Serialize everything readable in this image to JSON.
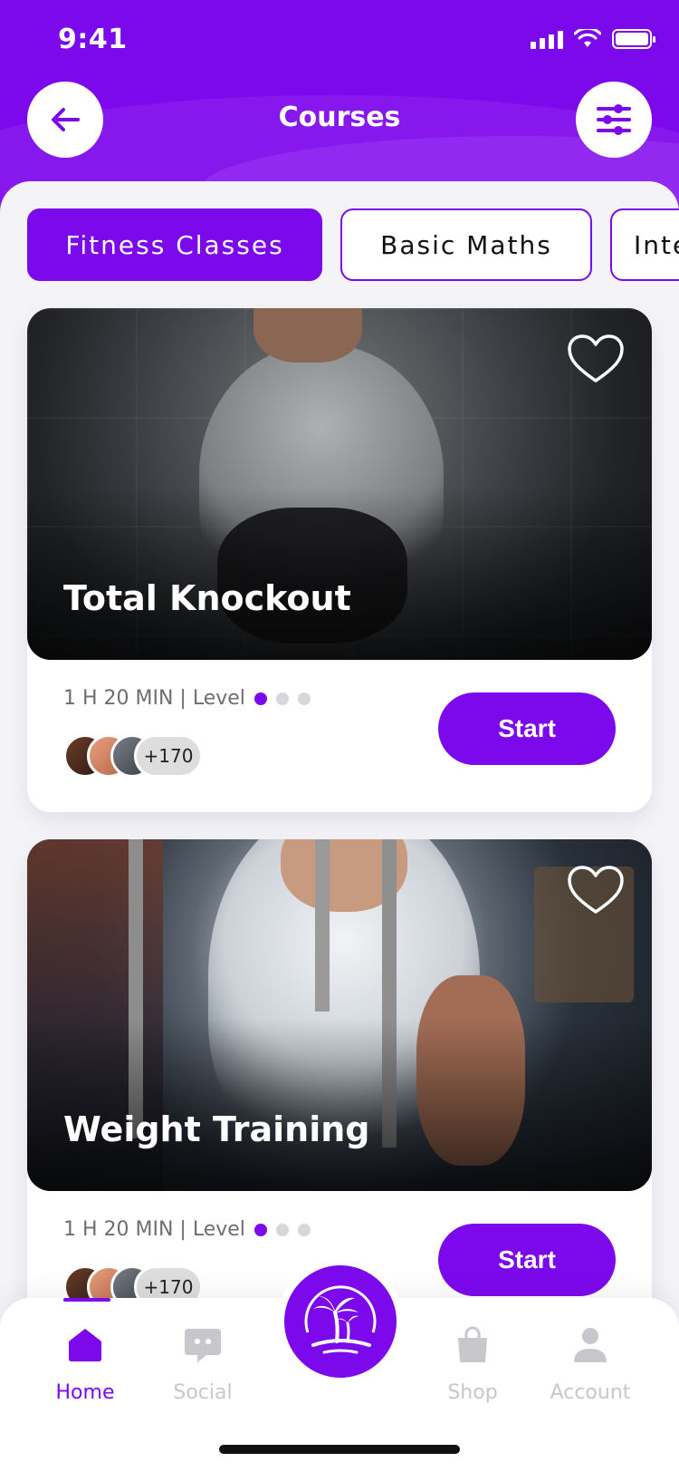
{
  "status_bar": {
    "time": "9:41"
  },
  "header": {
    "title": "Courses"
  },
  "tabs": [
    {
      "label": "Fitness Classes",
      "active": true
    },
    {
      "label": "Basic Maths",
      "active": false
    },
    {
      "label": "Inte",
      "active": false
    }
  ],
  "courses": [
    {
      "title": "Total Knockout",
      "duration": "1 H 20 MIN | Level",
      "level_active_dots": 1,
      "level_total_dots": 3,
      "participants_more": "+170",
      "button_label": "Start"
    },
    {
      "title": "Weight Training",
      "duration": "1 H 20 MIN | Level",
      "level_active_dots": 1,
      "level_total_dots": 3,
      "participants_more": "+170",
      "button_label": "Start"
    }
  ],
  "bottom_nav": [
    {
      "label": "Home",
      "icon": "home-icon",
      "active": true
    },
    {
      "label": "Social",
      "icon": "chat-icon",
      "active": false
    },
    {
      "label": "Shop",
      "icon": "shopping-bag-icon",
      "active": false
    },
    {
      "label": "Account",
      "icon": "user-icon",
      "active": false
    }
  ],
  "center_action": {
    "icon": "palm-island-icon"
  },
  "colors": {
    "primary": "#7c09ec",
    "inactive_nav": "#c7c7cc",
    "text_muted": "#6d6d73"
  }
}
